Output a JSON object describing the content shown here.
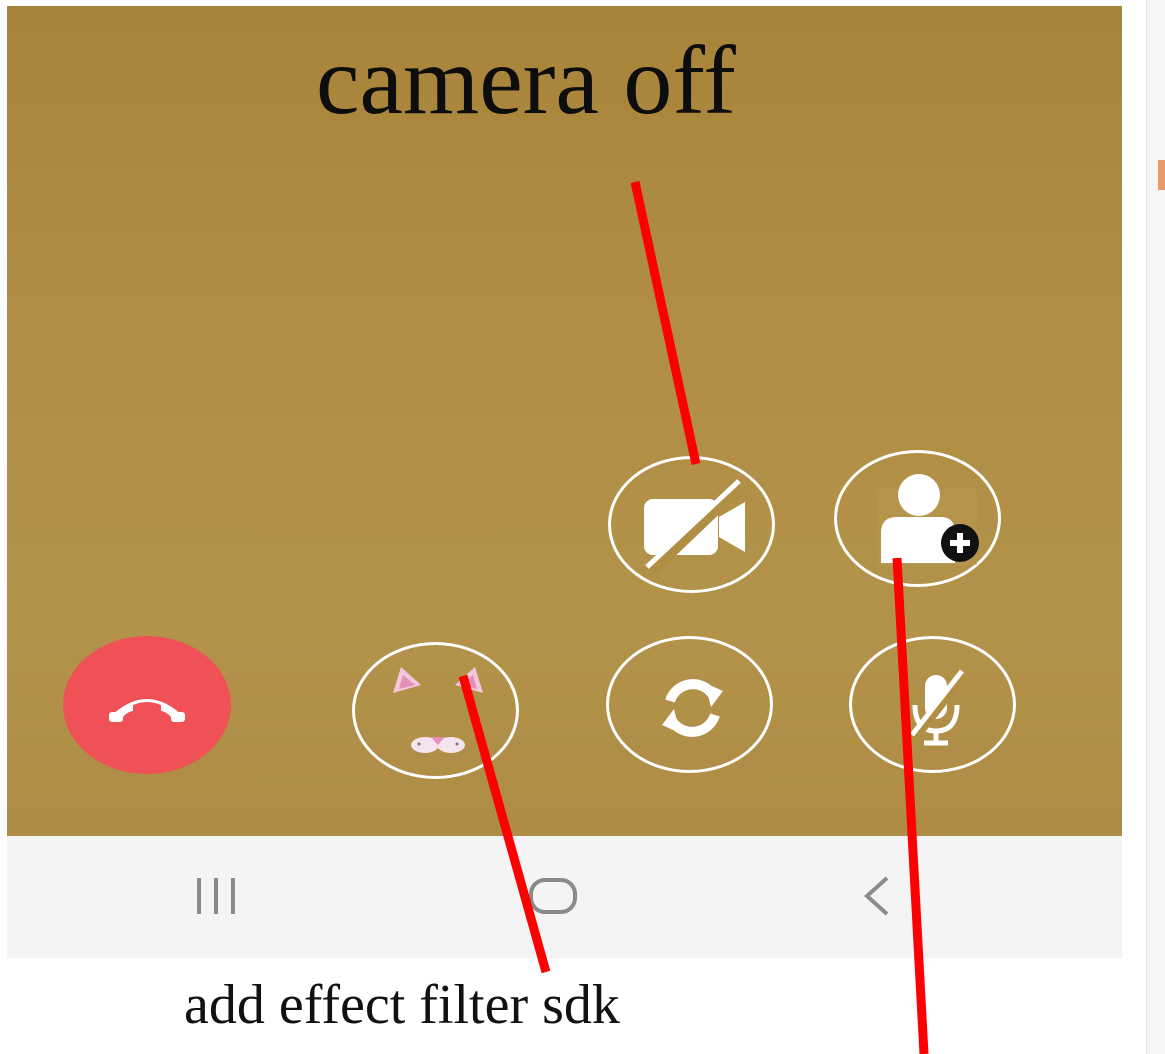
{
  "annotations": {
    "camera_off_label": "camera off",
    "effect_filter_label": "add effect filter sdk",
    "arrow_color": "#ff0000"
  },
  "call_controls": {
    "camera_off": {
      "icon": "video-off-icon"
    },
    "add_participant": {
      "icon": "person-add-icon"
    },
    "end_call": {
      "icon": "phone-hangup-icon",
      "color": "#ef5157"
    },
    "effect_filter": {
      "icon": "cat-ears-filter-icon"
    },
    "switch_camera": {
      "icon": "camera-switch-icon"
    },
    "mute_mic": {
      "icon": "mic-off-icon"
    }
  },
  "nav_bar": {
    "recents": {
      "icon": "recents-icon"
    },
    "home": {
      "icon": "home-icon"
    },
    "back": {
      "icon": "back-icon"
    }
  },
  "colors": {
    "video_background": "#b08e44",
    "nav_background": "#f4f4f4"
  }
}
